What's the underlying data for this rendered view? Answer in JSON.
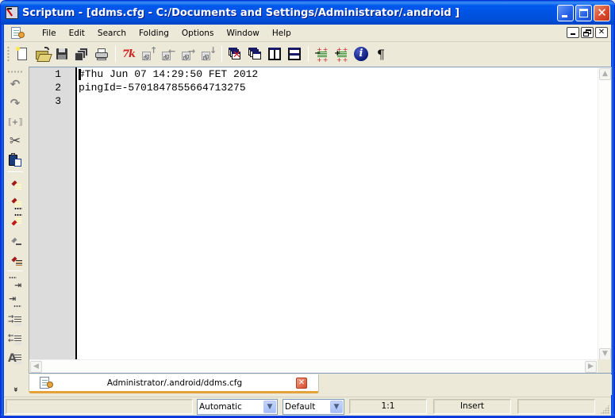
{
  "window": {
    "title": "Scriptum - [ddms.cfg - C:/Documents and Settings/Administrator/.android ]",
    "app_icon": "scriptum-app-icon",
    "controls": [
      {
        "name": "minimize-button",
        "icon": "minimize-icon"
      },
      {
        "name": "maximize-button",
        "icon": "maximize-icon"
      },
      {
        "name": "close-button",
        "icon": "close-icon",
        "glyph": "✕"
      }
    ]
  },
  "menubar": {
    "doc_icon": "document-icon",
    "items": [
      "File",
      "Edit",
      "Search",
      "Folding",
      "Options",
      "Window",
      "Help"
    ],
    "mdi_controls": [
      {
        "name": "mdi-minimize-button",
        "icon": "minimize-icon"
      },
      {
        "name": "mdi-restore-button",
        "icon": "restore-icon"
      },
      {
        "name": "mdi-close-button",
        "icon": "close-icon",
        "glyph": "✕"
      }
    ]
  },
  "toolbar": {
    "groups": [
      [
        "new-file",
        "open-file",
        "save-file",
        "save-all",
        "print"
      ],
      [
        "tcl-tk",
        "block-up",
        "block-left",
        "block-right",
        "block-down"
      ],
      [
        "close-all-windows",
        "cascade-windows",
        "split-vertical",
        "split-horizontal"
      ],
      [
        "fold-collapse",
        "fold-expand",
        "info",
        "show-whitespace"
      ]
    ],
    "tk_label": "7k",
    "info_glyph": "i",
    "pilcrow_glyph": "¶"
  },
  "side_toolbar": {
    "items": [
      "undo",
      "redo",
      "goto-matching",
      "cut",
      "paste",
      "mark-selection",
      "mark-to-end",
      "mark-from-start",
      "unmark",
      "mark-lines",
      "indent",
      "unindent",
      "add-paragraph",
      "remove-paragraph",
      "format-paragraph"
    ],
    "glyphs": {
      "undo": "↶",
      "redo": "↷",
      "goto": "⟦+⟧",
      "cut": "✂",
      "font_a": "A"
    },
    "more_glyph": "»"
  },
  "editor": {
    "line_numbers": [
      "1",
      "2",
      "3"
    ],
    "lines": [
      "#Thu Jun 07 14:29:50 FET 2012",
      "pingId=-5701847855664713275",
      ""
    ],
    "cursor": {
      "line": 1,
      "column": 1
    }
  },
  "tabs": [
    {
      "label": "Administrator/.android/ddms.cfg",
      "active": true,
      "close_glyph": "✕"
    }
  ],
  "statusbar": {
    "message": "",
    "encoding": {
      "value": "Automatic"
    },
    "highlighting": {
      "value": "Default"
    },
    "position": "1:1",
    "mode": "Insert",
    "extra": ""
  },
  "colors": {
    "titlebar": "#0054e3",
    "chrome": "#ece9d8",
    "gutter": "#dcdcdc",
    "tab_underline": "#e6a23a"
  }
}
